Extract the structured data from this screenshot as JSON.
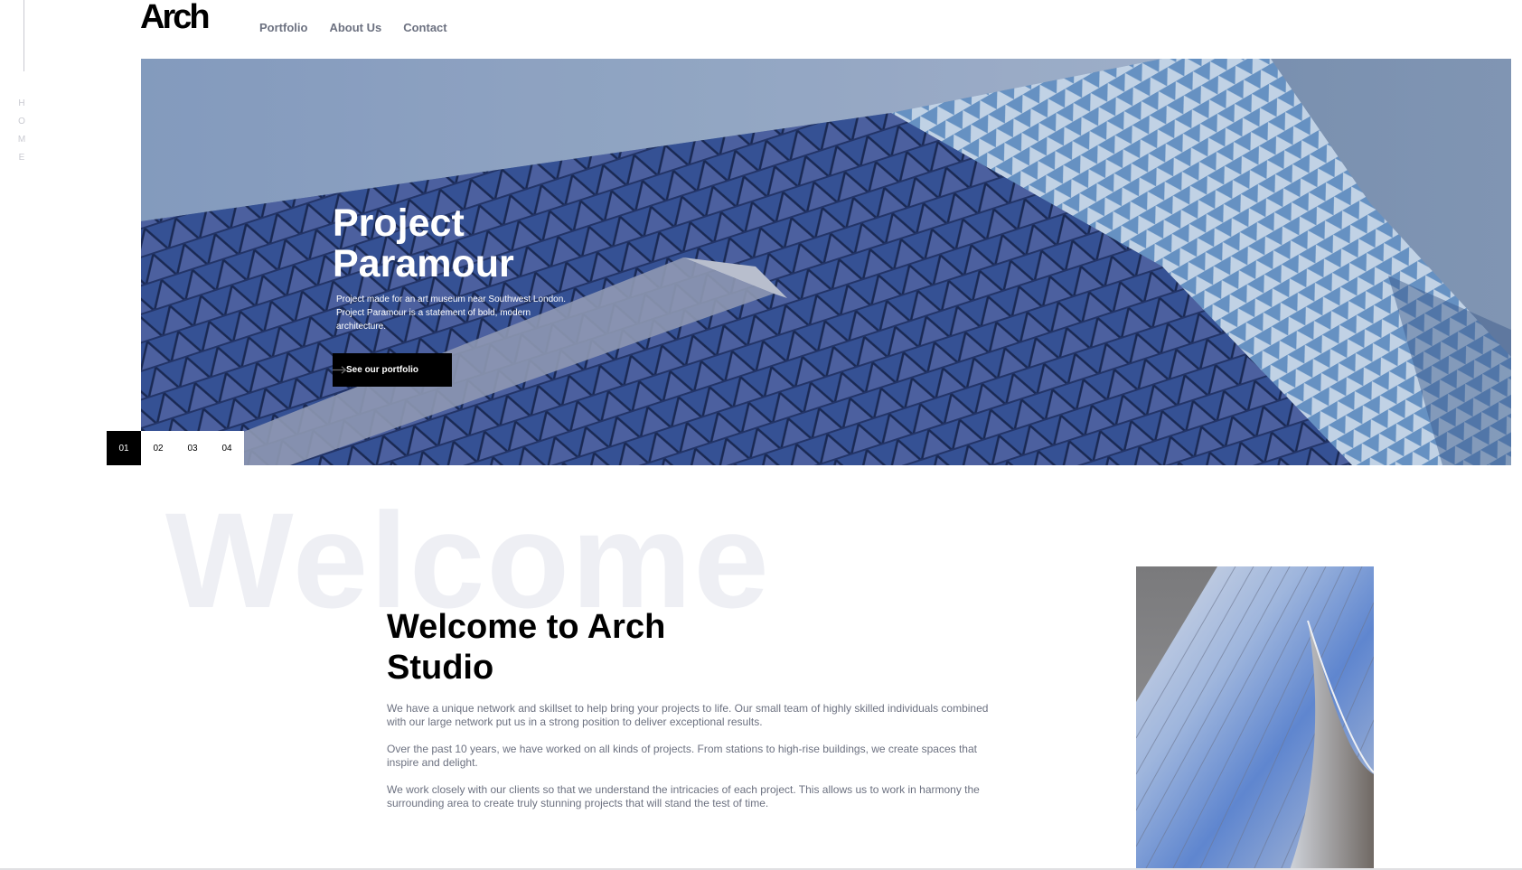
{
  "rail": {
    "label": [
      "H",
      "O",
      "M",
      "E"
    ]
  },
  "header": {
    "logo": "Arch",
    "nav": [
      "Portfolio",
      "About Us",
      "Contact"
    ]
  },
  "hero": {
    "title": "Project Paramour",
    "description": "Project made for an art museum near Southwest London. Project Paramour is a statement of bold, modern architecture.",
    "cta_label": "See our portfolio"
  },
  "pager": {
    "items": [
      "01",
      "02",
      "03",
      "04"
    ],
    "active": "01"
  },
  "welcome": {
    "background_word": "Welcome",
    "title": "Welcome to Arch Studio",
    "paragraphs": [
      "We have a unique network and skillset to help bring your projects to life. Our small team of highly skilled individuals combined with our large network put us in a strong position to deliver exceptional results.",
      "Over the past 10 years, we have worked on all kinds of projects. From stations to high-rise buildings, we create spaces that inspire and delight.",
      "We work closely with our clients so that we understand the intricacies of each project. This allows us to work in harmony the surrounding area to create truly stunning projects that will stand the test of time."
    ]
  },
  "colors": {
    "accent": "#000000",
    "muted_text": "#6c7180",
    "faint": "#eeeff4"
  }
}
